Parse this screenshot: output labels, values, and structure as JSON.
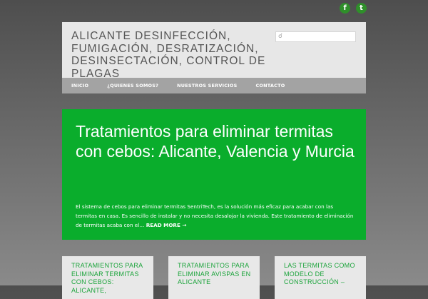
{
  "social": {
    "facebook_glyph": "f",
    "twitter_glyph": "t"
  },
  "header": {
    "site_title": "Alicante Desinfección, Fumigación, Desratización, Desinsectación, Control de Plagas",
    "search_placeholder": ""
  },
  "nav": {
    "items": [
      {
        "label": "Inicio"
      },
      {
        "label": "¿Quienes somos?"
      },
      {
        "label": "Nuestros servicios"
      },
      {
        "label": "Contacto"
      }
    ]
  },
  "feature": {
    "title": "Tratamientos para eliminar termitas con cebos: Alicante, Valencia y Murcia",
    "excerpt": "El sistema de cebos para eliminar termitas SentriTech, es la solución más eficaz para acabar con las termitas en casa. Es sencillo de instalar y no necesita desalojar la vivienda. Este tratamiento de eliminación de termitas acaba con el… ",
    "read_more": "READ MORE →"
  },
  "cards": [
    {
      "title": "Tratamientos para eliminar termitas con cebos: Alicante,"
    },
    {
      "title": "Tratamientos para eliminar avispas en Alicante"
    },
    {
      "title": "Las termitas como modelo de construcción –"
    }
  ],
  "colors": {
    "accent_green": "#0aad2c",
    "card_title_green": "#1aa33a"
  }
}
